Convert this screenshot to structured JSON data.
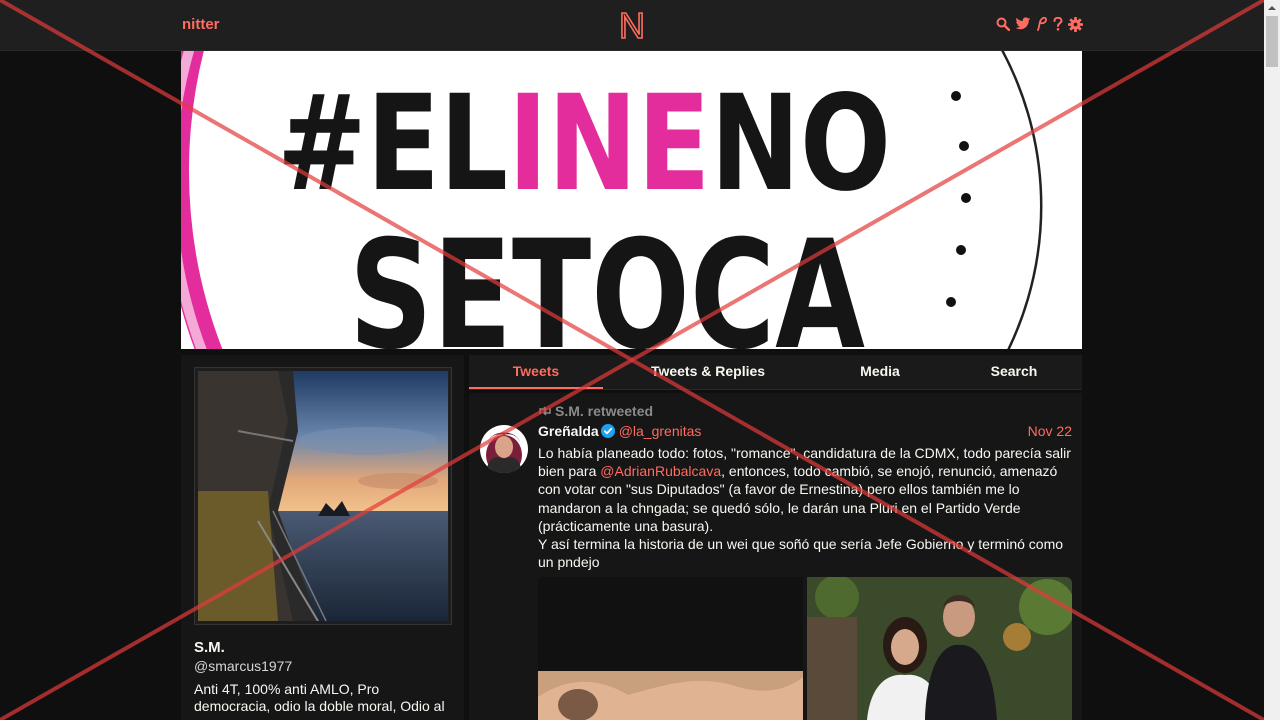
{
  "navbar": {
    "brand": "nitter",
    "logo_letter": "N",
    "icons": [
      "search-icon",
      "twitter-bird-icon",
      "rss-icon",
      "help-icon",
      "gear-icon"
    ]
  },
  "banner": {
    "line1_prefix": "#EL",
    "line1_highlight": "INE",
    "line1_suffix": "NO",
    "line2": "SETOCA"
  },
  "profile": {
    "fullname": "S.M.",
    "username": "@smarcus1977",
    "bio": "Anti 4T, 100% anti AMLO, Pro democracia, odio la doble moral, Odio al"
  },
  "tabs": [
    {
      "label": "Tweets",
      "active": true
    },
    {
      "label": "Tweets & Replies",
      "active": false
    },
    {
      "label": "Media",
      "active": false
    },
    {
      "label": "Search",
      "active": false
    }
  ],
  "tweet": {
    "retweet_header": "S.M. retweeted",
    "fullname": "Greñalda",
    "username": "@la_grenitas",
    "date": "Nov 22",
    "content_part1": "Lo había planeado todo: fotos, \"romance\", candidatura de la CDMX, todo parecía salir bien para ",
    "mention": "@AdrianRubalcava",
    "content_part2": ", entonces, todo cambió, se enojó, renunció, amenazó con votar con \"sus Diputados\" (a favor de Ernestina) pero ellos también me lo mandaron a la chngada; se quedó sólo, le darán una Pluri en el Partido Verde (prácticamente una basura).\nY así termina la historia de un wei que soñó que sería Jefe Gobierno y terminó como un pndejo"
  },
  "colors": {
    "accent": "#ff6c60",
    "background": "#0f0f0f",
    "panel": "#161616",
    "verified": "#1da1f2",
    "banner_highlight": "#e32d9d"
  }
}
